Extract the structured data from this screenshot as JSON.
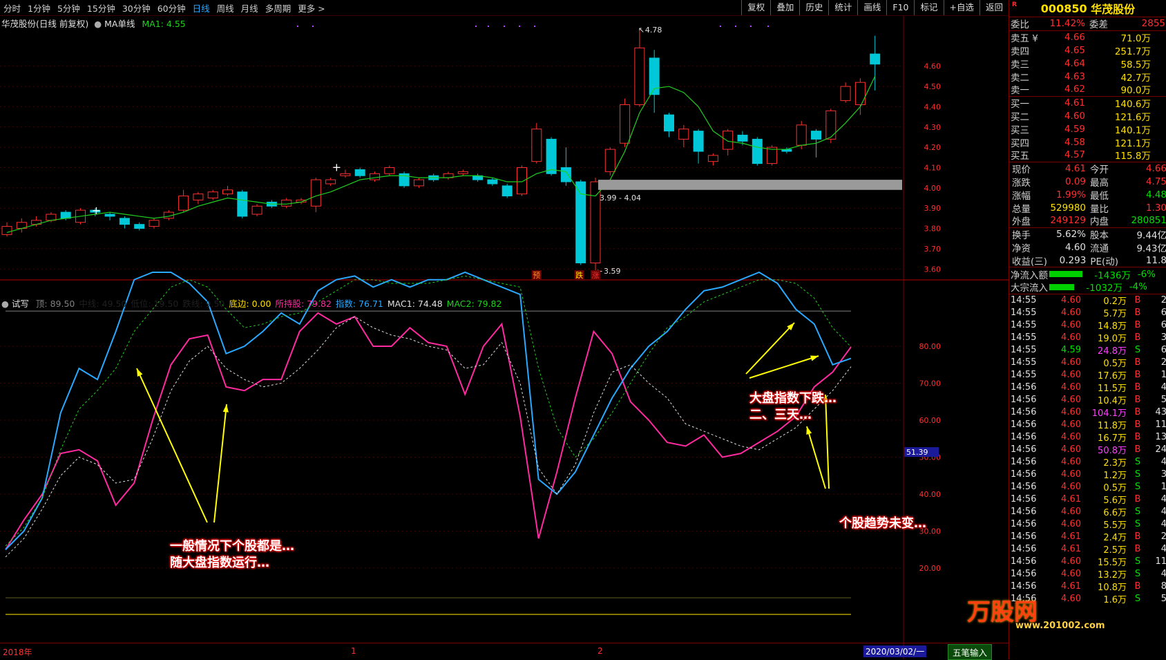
{
  "toolbar": {
    "periods": [
      "分时",
      "1分钟",
      "5分钟",
      "15分钟",
      "30分钟",
      "60分钟",
      "日线",
      "周线",
      "月线",
      "多周期",
      "更多 >"
    ],
    "active_period": "日线",
    "right_buttons": [
      "复权",
      "叠加",
      "历史",
      "统计",
      "画线",
      "F10",
      "标记",
      "+自选",
      "返回"
    ]
  },
  "main_chart": {
    "title": "华茂股份(日线 前复权)",
    "indicator": "MA单线",
    "ma_label": "MA1: 4.55",
    "high_marker": "4.78",
    "low_marker": "3.59",
    "gap_label": "3.99 - 4.04",
    "signal_labels": [
      "预",
      "跌",
      "涨"
    ],
    "price_ticks": [
      "4.60",
      "4.50",
      "4.40",
      "4.30",
      "4.20",
      "4.10",
      "4.00",
      "3.90",
      "3.80",
      "3.70",
      "3.60"
    ]
  },
  "sub_chart": {
    "name": "试写",
    "legend": [
      {
        "text": "顶: 89.50",
        "color": "#808080"
      },
      {
        "text": "中线: 49.50",
        "color": "#202020"
      },
      {
        "text": "低位: 19.50",
        "color": "#202020"
      },
      {
        "text": "跌线: 9.50",
        "color": "#202020"
      },
      {
        "text": "底边: 0.00",
        "color": "#ffe000"
      },
      {
        "text": "所持股: 79.82",
        "color": "#ff2aa0"
      },
      {
        "text": "指数: 76.71",
        "color": "#29a9ff"
      },
      {
        "text": "MAC1: 74.48",
        "color": "#e0e0e0"
      },
      {
        "text": "MAC2: 79.82",
        "color": "#20d020"
      }
    ],
    "ticks": [
      "80.00",
      "70.00",
      "60.00",
      "50.00",
      "40.00",
      "30.00",
      "20.00"
    ],
    "current_marker": "51.39"
  },
  "annotations": {
    "left_line1": "一般情况下个股都是…",
    "left_line2": "随大盘指数运行…",
    "right_top_line1": "大盘指数下跌…",
    "right_top_line2": "二、三天…",
    "right_bottom": "个股趋势未变…"
  },
  "time_axis": {
    "start": "2018年",
    "mark1": "1",
    "mark2": "2",
    "end": "2020/03/02/一"
  },
  "quote": {
    "code": "000850",
    "name": "华茂股份",
    "r_mark": "R",
    "weibi": {
      "label": "委比",
      "value": "11.42%",
      "label2": "委差",
      "value2": "2855"
    },
    "asks": [
      {
        "label": "卖五 ¥",
        "price": "4.66",
        "vol": "71.0万"
      },
      {
        "label": "卖四",
        "price": "4.65",
        "vol": "251.7万"
      },
      {
        "label": "卖三",
        "price": "4.64",
        "vol": "58.5万"
      },
      {
        "label": "卖二",
        "price": "4.63",
        "vol": "42.7万"
      },
      {
        "label": "卖一",
        "price": "4.62",
        "vol": "90.0万"
      }
    ],
    "bids": [
      {
        "label": "买一",
        "price": "4.61",
        "vol": "140.6万"
      },
      {
        "label": "买二",
        "price": "4.60",
        "vol": "121.6万"
      },
      {
        "label": "买三",
        "price": "4.59",
        "vol": "140.1万"
      },
      {
        "label": "买四",
        "price": "4.58",
        "vol": "121.1万"
      },
      {
        "label": "买五",
        "price": "4.57",
        "vol": "115.8万"
      }
    ],
    "stats1": [
      {
        "l1": "现价",
        "v1": "4.61",
        "c1": "red",
        "l2": "今开",
        "v2": "4.66",
        "c2": "red"
      },
      {
        "l1": "涨跌",
        "v1": "0.09",
        "c1": "red",
        "l2": "最高",
        "v2": "4.75",
        "c2": "red"
      },
      {
        "l1": "涨幅",
        "v1": "1.99%",
        "c1": "red",
        "l2": "最低",
        "v2": "4.48",
        "c2": "green"
      },
      {
        "l1": "总量",
        "v1": "529980",
        "c1": "yellow",
        "l2": "量比",
        "v2": "1.30",
        "c2": "red"
      },
      {
        "l1": "外盘",
        "v1": "249129",
        "c1": "red",
        "l2": "内盘",
        "v2": "280851",
        "c2": "green"
      }
    ],
    "stats2": [
      {
        "l1": "换手",
        "v1": "5.62%",
        "l2": "股本",
        "v2": "9.44亿"
      },
      {
        "l1": "净资",
        "v1": "4.60",
        "l2": "流通",
        "v2": "9.43亿"
      },
      {
        "l1": "收益(三)",
        "v1": "0.293",
        "l2": "PE(动)",
        "v2": "11.8"
      }
    ],
    "flows": [
      {
        "label": "净流入额",
        "value": "-1436万",
        "pct": "-6%",
        "bar": 0.6
      },
      {
        "label": "大宗流入",
        "value": "-1032万",
        "pct": "-4%",
        "bar": 0.45
      }
    ],
    "ticks": [
      {
        "t": "14:55",
        "p": "4.60",
        "v": "0.2万",
        "d": "B",
        "n": "2"
      },
      {
        "t": "14:55",
        "p": "4.60",
        "v": "5.7万",
        "d": "B",
        "n": "6"
      },
      {
        "t": "14:55",
        "p": "4.60",
        "v": "14.8万",
        "d": "B",
        "n": "6"
      },
      {
        "t": "14:55",
        "p": "4.60",
        "v": "19.0万",
        "d": "B",
        "n": "3"
      },
      {
        "t": "14:55",
        "p": "4.59",
        "v": "24.8万",
        "d": "S",
        "n": "6"
      },
      {
        "t": "14:55",
        "p": "4.60",
        "v": "0.5万",
        "d": "B",
        "n": "2"
      },
      {
        "t": "14:55",
        "p": "4.60",
        "v": "17.6万",
        "d": "B",
        "n": "1"
      },
      {
        "t": "14:56",
        "p": "4.60",
        "v": "11.5万",
        "d": "B",
        "n": "4"
      },
      {
        "t": "14:56",
        "p": "4.60",
        "v": "10.4万",
        "d": "B",
        "n": "5"
      },
      {
        "t": "14:56",
        "p": "4.60",
        "v": "104.1万",
        "d": "B",
        "n": "43"
      },
      {
        "t": "14:56",
        "p": "4.60",
        "v": "11.8万",
        "d": "B",
        "n": "11"
      },
      {
        "t": "14:56",
        "p": "4.60",
        "v": "16.7万",
        "d": "B",
        "n": "13"
      },
      {
        "t": "14:56",
        "p": "4.60",
        "v": "50.8万",
        "d": "B",
        "n": "24"
      },
      {
        "t": "14:56",
        "p": "4.60",
        "v": "2.3万",
        "d": "S",
        "n": "4"
      },
      {
        "t": "14:56",
        "p": "4.60",
        "v": "1.2万",
        "d": "S",
        "n": "3"
      },
      {
        "t": "14:56",
        "p": "4.60",
        "v": "0.5万",
        "d": "S",
        "n": "1"
      },
      {
        "t": "14:56",
        "p": "4.61",
        "v": "5.6万",
        "d": "B",
        "n": "4"
      },
      {
        "t": "14:56",
        "p": "4.60",
        "v": "6.6万",
        "d": "S",
        "n": "4"
      },
      {
        "t": "14:56",
        "p": "4.60",
        "v": "5.5万",
        "d": "S",
        "n": "4"
      },
      {
        "t": "14:56",
        "p": "4.61",
        "v": "2.4万",
        "d": "B",
        "n": "2"
      },
      {
        "t": "14:56",
        "p": "4.61",
        "v": "2.5万",
        "d": "B",
        "n": "4"
      },
      {
        "t": "14:56",
        "p": "4.60",
        "v": "15.5万",
        "d": "S",
        "n": "11"
      },
      {
        "t": "14:56",
        "p": "4.60",
        "v": "13.2万",
        "d": "S",
        "n": "4"
      },
      {
        "t": "14:56",
        "p": "4.61",
        "v": "10.8万",
        "d": "B",
        "n": "8"
      },
      {
        "t": "14:56",
        "p": "4.60",
        "v": "1.6万",
        "d": "S",
        "n": "5"
      }
    ],
    "watermark": "万股网",
    "watermark_url": "www.201002.com",
    "wubi_button": "五笔输入"
  },
  "chart_data": [
    {
      "type": "candlestick",
      "title": "华茂股份(日线 前复权)",
      "ylim": [
        3.56,
        4.8
      ],
      "candles": [
        {
          "o": 3.77,
          "c": 3.81,
          "h": 3.83,
          "l": 3.76
        },
        {
          "o": 3.8,
          "c": 3.83,
          "h": 3.85,
          "l": 3.78
        },
        {
          "o": 3.82,
          "c": 3.84,
          "h": 3.86,
          "l": 3.81
        },
        {
          "o": 3.84,
          "c": 3.87,
          "h": 3.88,
          "l": 3.83
        },
        {
          "o": 3.88,
          "c": 3.85,
          "h": 3.89,
          "l": 3.84
        },
        {
          "o": 3.83,
          "c": 3.89,
          "h": 3.9,
          "l": 3.82
        },
        {
          "o": 3.89,
          "c": 3.88,
          "h": 3.9,
          "l": 3.86
        },
        {
          "o": 3.87,
          "c": 3.86,
          "h": 3.88,
          "l": 3.84
        },
        {
          "o": 3.85,
          "c": 3.82,
          "h": 3.86,
          "l": 3.8
        },
        {
          "o": 3.82,
          "c": 3.8,
          "h": 3.83,
          "l": 3.79
        },
        {
          "o": 3.81,
          "c": 3.84,
          "h": 3.85,
          "l": 3.8
        },
        {
          "o": 3.85,
          "c": 3.88,
          "h": 3.89,
          "l": 3.84
        },
        {
          "o": 3.89,
          "c": 3.96,
          "h": 3.99,
          "l": 3.88
        },
        {
          "o": 3.94,
          "c": 3.97,
          "h": 3.98,
          "l": 3.92
        },
        {
          "o": 3.95,
          "c": 3.98,
          "h": 3.99,
          "l": 3.94
        },
        {
          "o": 3.97,
          "c": 3.99,
          "h": 4.01,
          "l": 3.96
        },
        {
          "o": 3.98,
          "c": 3.86,
          "h": 3.99,
          "l": 3.85
        },
        {
          "o": 3.87,
          "c": 3.91,
          "h": 3.92,
          "l": 3.86
        },
        {
          "o": 3.93,
          "c": 3.91,
          "h": 3.94,
          "l": 3.9
        },
        {
          "o": 3.91,
          "c": 3.94,
          "h": 3.95,
          "l": 3.9
        },
        {
          "o": 3.93,
          "c": 3.94,
          "h": 3.95,
          "l": 3.92
        },
        {
          "o": 3.91,
          "c": 4.04,
          "h": 4.05,
          "l": 3.88
        },
        {
          "o": 4.02,
          "c": 4.04,
          "h": 4.05,
          "l": 4.01
        },
        {
          "o": 4.06,
          "c": 4.07,
          "h": 4.09,
          "l": 4.05
        },
        {
          "o": 4.09,
          "c": 4.06,
          "h": 4.1,
          "l": 4.05
        },
        {
          "o": 4.04,
          "c": 4.07,
          "h": 4.08,
          "l": 4.03
        },
        {
          "o": 4.07,
          "c": 4.1,
          "h": 4.11,
          "l": 4.06
        },
        {
          "o": 4.07,
          "c": 4.01,
          "h": 4.08,
          "l": 4.0
        },
        {
          "o": 4.01,
          "c": 4.04,
          "h": 4.05,
          "l": 4.0
        },
        {
          "o": 4.06,
          "c": 4.04,
          "h": 4.07,
          "l": 4.03
        },
        {
          "o": 4.05,
          "c": 4.07,
          "h": 4.08,
          "l": 4.04
        },
        {
          "o": 4.07,
          "c": 4.08,
          "h": 4.09,
          "l": 4.06
        },
        {
          "o": 4.06,
          "c": 4.04,
          "h": 4.07,
          "l": 4.03
        },
        {
          "o": 4.04,
          "c": 4.02,
          "h": 4.05,
          "l": 4.01
        },
        {
          "o": 4.01,
          "c": 3.96,
          "h": 4.02,
          "l": 3.95
        },
        {
          "o": 3.97,
          "c": 4.1,
          "h": 4.11,
          "l": 3.96
        },
        {
          "o": 4.13,
          "c": 4.29,
          "h": 4.32,
          "l": 4.12
        },
        {
          "o": 4.24,
          "c": 4.07,
          "h": 4.25,
          "l": 4.06
        },
        {
          "o": 4.1,
          "c": 4.03,
          "h": 4.2,
          "l": 4.01
        },
        {
          "o": 4.03,
          "c": 3.63,
          "h": 4.04,
          "l": 3.62
        },
        {
          "o": 3.63,
          "c": 4.03,
          "h": 4.05,
          "l": 3.59
        },
        {
          "o": 4.08,
          "c": 4.19,
          "h": 4.2,
          "l": 4.06
        },
        {
          "o": 4.22,
          "c": 4.41,
          "h": 4.44,
          "l": 4.2
        },
        {
          "o": 4.41,
          "c": 4.69,
          "h": 4.78,
          "l": 4.4
        },
        {
          "o": 4.64,
          "c": 4.46,
          "h": 4.68,
          "l": 4.37
        },
        {
          "o": 4.36,
          "c": 4.28,
          "h": 4.37,
          "l": 4.25
        },
        {
          "o": 4.24,
          "c": 4.29,
          "h": 4.31,
          "l": 4.2
        },
        {
          "o": 4.28,
          "c": 4.18,
          "h": 4.29,
          "l": 4.12
        },
        {
          "o": 4.13,
          "c": 4.16,
          "h": 4.17,
          "l": 4.11
        },
        {
          "o": 4.19,
          "c": 4.28,
          "h": 4.29,
          "l": 4.16
        },
        {
          "o": 4.26,
          "c": 4.23,
          "h": 4.28,
          "l": 4.21
        },
        {
          "o": 4.24,
          "c": 4.12,
          "h": 4.25,
          "l": 4.11
        },
        {
          "o": 4.12,
          "c": 4.2,
          "h": 4.21,
          "l": 4.11
        },
        {
          "o": 4.19,
          "c": 4.18,
          "h": 4.2,
          "l": 4.17
        },
        {
          "o": 4.21,
          "c": 4.31,
          "h": 4.33,
          "l": 4.19
        },
        {
          "o": 4.28,
          "c": 4.24,
          "h": 4.29,
          "l": 4.15
        },
        {
          "o": 4.24,
          "c": 4.38,
          "h": 4.39,
          "l": 4.22
        },
        {
          "o": 4.43,
          "c": 4.5,
          "h": 4.52,
          "l": 4.42
        },
        {
          "o": 4.41,
          "c": 4.52,
          "h": 4.54,
          "l": 4.36
        },
        {
          "o": 4.66,
          "c": 4.61,
          "h": 4.75,
          "l": 4.48
        }
      ],
      "ma": [
        3.78,
        3.8,
        3.82,
        3.84,
        3.85,
        3.86,
        3.87,
        3.88,
        3.87,
        3.86,
        3.85,
        3.86,
        3.88,
        3.91,
        3.93,
        3.95,
        3.94,
        3.93,
        3.92,
        3.92,
        3.93,
        3.96,
        3.98,
        4.01,
        4.04,
        4.05,
        4.06,
        4.06,
        4.05,
        4.05,
        4.05,
        4.06,
        4.06,
        4.05,
        4.03,
        4.03,
        4.07,
        4.09,
        4.08,
        3.97,
        3.96,
        4.04,
        4.18,
        4.37,
        4.49,
        4.5,
        4.47,
        4.4,
        4.28,
        4.23,
        4.22,
        4.2,
        4.19,
        4.19,
        4.21,
        4.22,
        4.25,
        4.32,
        4.4,
        4.55
      ]
    },
    {
      "type": "line",
      "title": "试写",
      "ylim": [
        0,
        100
      ],
      "series": [
        {
          "name": "所持股",
          "color": "#ff2aa0",
          "values": [
            25,
            33,
            40,
            51,
            52,
            49,
            37,
            43,
            60,
            75,
            82,
            83,
            69,
            68,
            71,
            71,
            84,
            89,
            86,
            88,
            80,
            80,
            85,
            81,
            80,
            67,
            80,
            86,
            61,
            28,
            46,
            66,
            84,
            78,
            65,
            60,
            54,
            53,
            56,
            50,
            51,
            54,
            57,
            61,
            69,
            73,
            79.82
          ]
        },
        {
          "name": "指数",
          "color": "#29a9ff",
          "values": [
            25,
            30,
            39,
            62,
            74,
            71,
            84,
            98,
            100,
            100,
            97,
            92,
            78,
            80,
            84,
            89,
            86,
            95,
            98,
            99,
            96,
            98,
            96,
            98,
            98,
            100,
            98,
            96,
            94,
            44,
            40,
            46,
            56,
            66,
            74,
            80,
            84,
            90,
            95,
            96,
            98,
            100,
            97,
            90,
            86,
            75,
            76.71
          ]
        },
        {
          "name": "MAC1",
          "color": "#e0e0e0",
          "values": [
            23,
            28,
            36,
            45,
            50,
            48,
            43,
            44,
            55,
            68,
            76,
            80,
            74,
            71,
            69,
            70,
            74,
            79,
            85,
            88,
            85,
            83,
            82,
            80,
            79,
            74,
            75,
            81,
            70,
            47,
            40,
            48,
            62,
            73,
            75,
            70,
            66,
            59,
            57,
            55,
            53,
            52,
            55,
            58,
            63,
            68,
            74.48
          ]
        },
        {
          "name": "MAC2",
          "color": "#20d020",
          "values": [
            26,
            31,
            39,
            52,
            63,
            68,
            74,
            84,
            90,
            96,
            98,
            96,
            90,
            85,
            86,
            88,
            89,
            92,
            95,
            98,
            98,
            97,
            97,
            97,
            98,
            99,
            98,
            97,
            96,
            74,
            58,
            50,
            55,
            62,
            70,
            78,
            85,
            88,
            92,
            94,
            96,
            98,
            98,
            97,
            93,
            85,
            79.82
          ]
        }
      ]
    }
  ]
}
